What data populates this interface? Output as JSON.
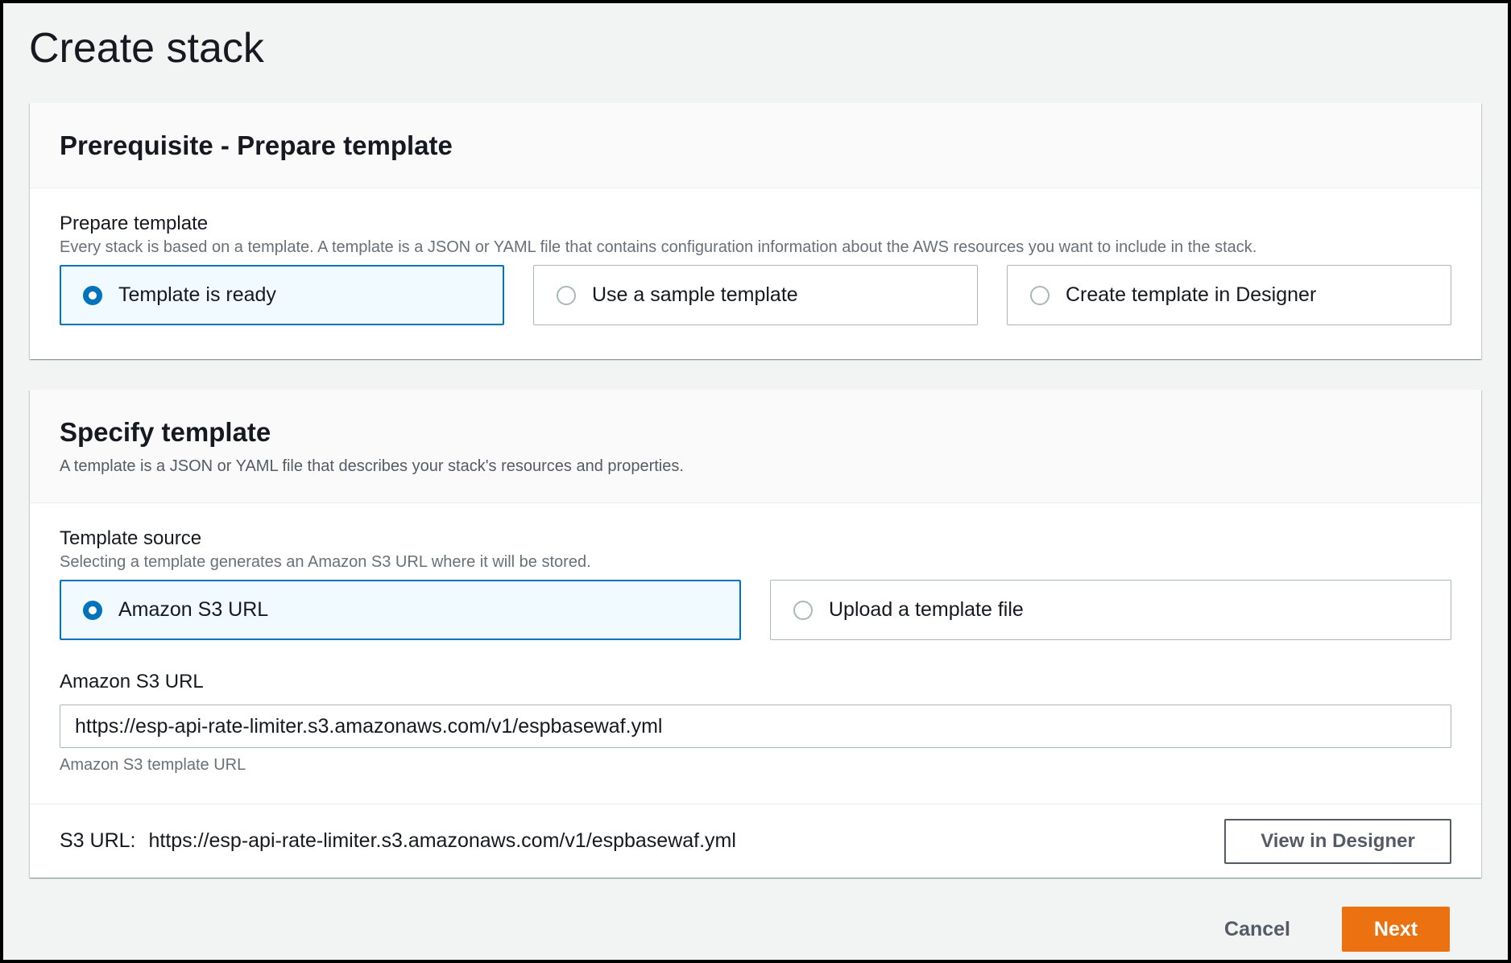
{
  "page": {
    "title": "Create stack"
  },
  "prerequisite": {
    "title": "Prerequisite - Prepare template",
    "field_label": "Prepare template",
    "field_desc": "Every stack is based on a template. A template is a JSON or YAML file that contains configuration information about the AWS resources you want to include in the stack.",
    "options": [
      {
        "label": "Template is ready",
        "selected": true
      },
      {
        "label": "Use a sample template",
        "selected": false
      },
      {
        "label": "Create template in Designer",
        "selected": false
      }
    ]
  },
  "specify": {
    "title": "Specify template",
    "desc": "A template is a JSON or YAML file that describes your stack's resources and properties.",
    "source_label": "Template source",
    "source_desc": "Selecting a template generates an Amazon S3 URL where it will be stored.",
    "options": [
      {
        "label": "Amazon S3 URL",
        "selected": true
      },
      {
        "label": "Upload a template file",
        "selected": false
      }
    ],
    "url_label": "Amazon S3 URL",
    "url_value": "https://esp-api-rate-limiter.s3.amazonaws.com/v1/espbasewaf.yml",
    "url_constraint": "Amazon S3 template URL",
    "s3_prefix": "S3 URL:",
    "s3_value": "https://esp-api-rate-limiter.s3.amazonaws.com/v1/espbasewaf.yml",
    "designer_button": "View in Designer"
  },
  "actions": {
    "cancel": "Cancel",
    "next": "Next"
  },
  "colors": {
    "accent": "#0073bb",
    "primary": "#ec7211",
    "background": "#f2f3f3"
  }
}
